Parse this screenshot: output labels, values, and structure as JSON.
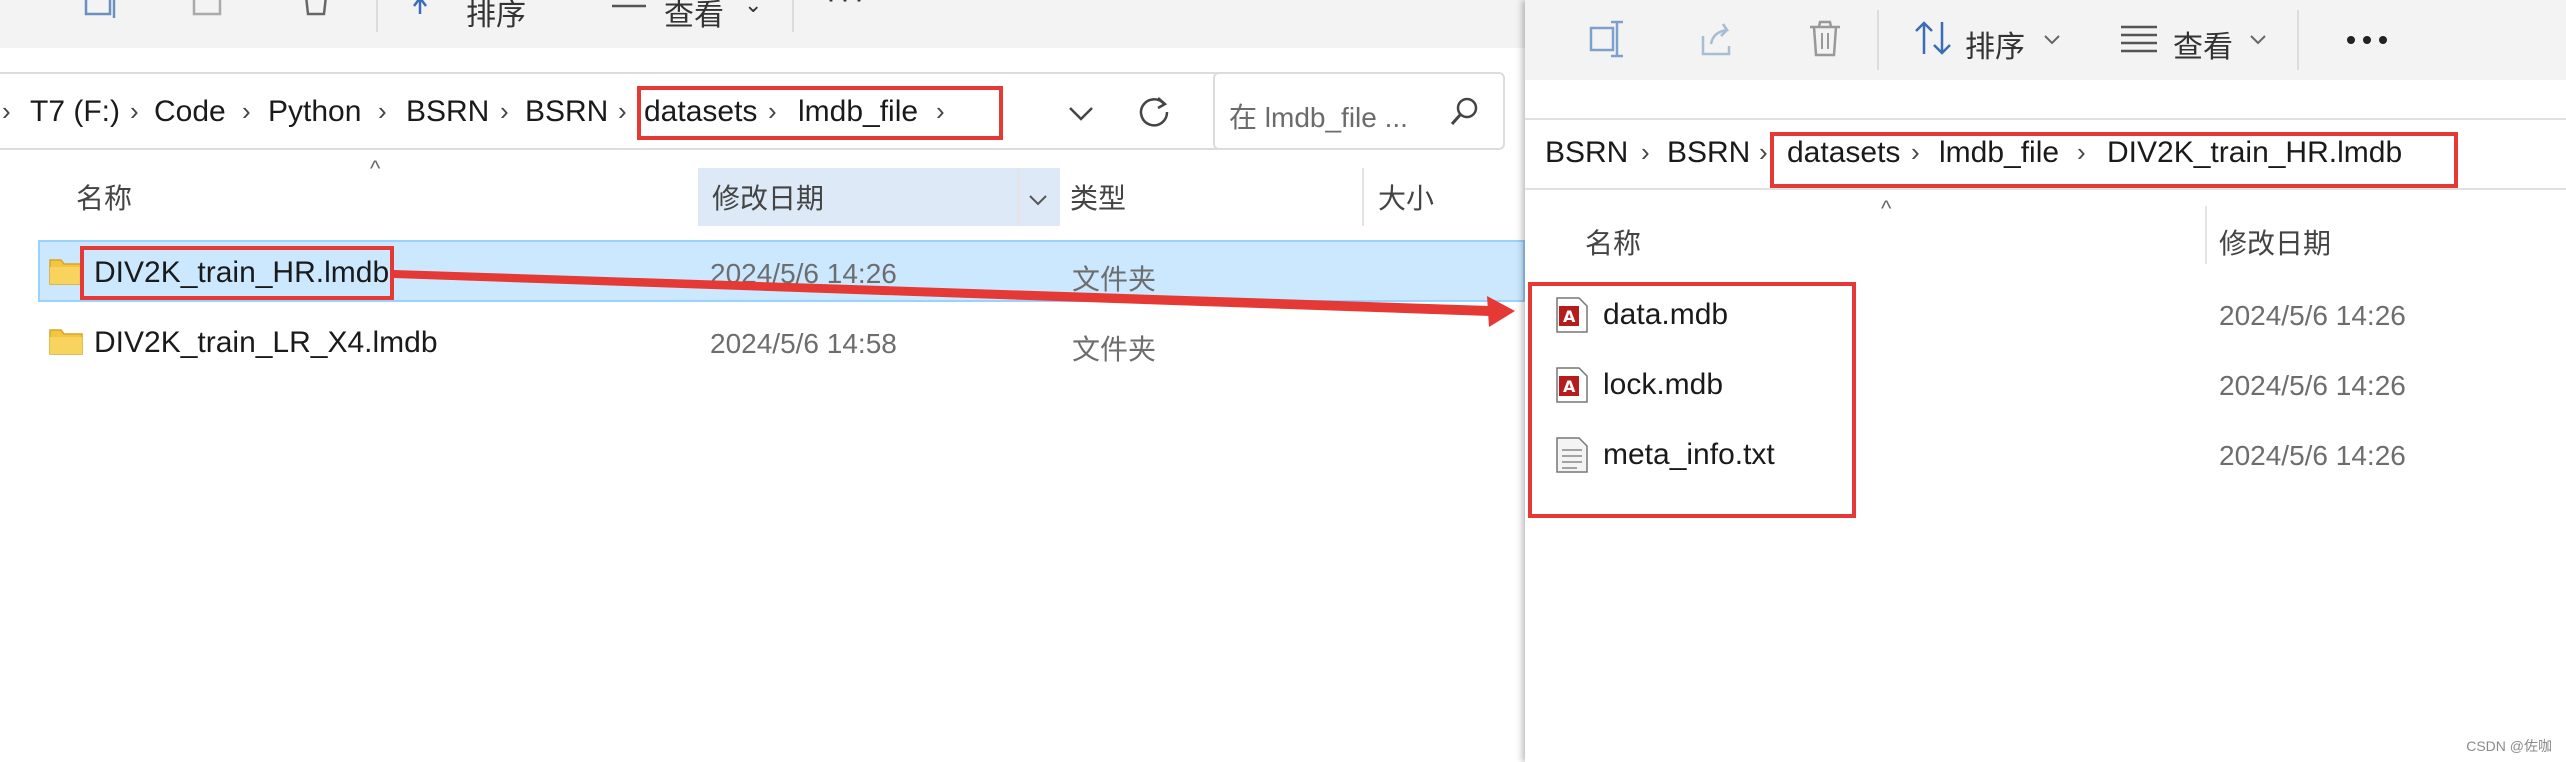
{
  "left_window": {
    "toolbar": {
      "sort_label": "排序",
      "view_label": "查看"
    },
    "breadcrumb": [
      "T7 (F:)",
      "Code",
      "Python",
      "BSRN",
      "BSRN",
      "datasets",
      "lmdb_file"
    ],
    "search_placeholder": "在 lmdb_file ...",
    "columns": {
      "name": "名称",
      "date": "修改日期",
      "type": "类型",
      "size": "大小"
    },
    "rows": [
      {
        "name": "DIV2K_train_HR.lmdb",
        "date": "2024/5/6 14:26",
        "type": "文件夹",
        "selected": true
      },
      {
        "name": "DIV2K_train_LR_X4.lmdb",
        "date": "2024/5/6 14:58",
        "type": "文件夹",
        "selected": false
      }
    ]
  },
  "right_window": {
    "toolbar": {
      "sort_label": "排序",
      "view_label": "查看"
    },
    "breadcrumb": [
      "BSRN",
      "BSRN",
      "datasets",
      "lmdb_file",
      "DIV2K_train_HR.lmdb"
    ],
    "columns": {
      "name": "名称",
      "date": "修改日期"
    },
    "rows": [
      {
        "name": "data.mdb",
        "date": "2024/5/6 14:26",
        "icon": "mdb-file-icon"
      },
      {
        "name": "lock.mdb",
        "date": "2024/5/6 14:26",
        "icon": "mdb-file-icon"
      },
      {
        "name": "meta_info.txt",
        "date": "2024/5/6 14:26",
        "icon": "text-file-icon"
      }
    ]
  },
  "annotation_color": "#e53935",
  "watermark": "CSDN @佐咖"
}
